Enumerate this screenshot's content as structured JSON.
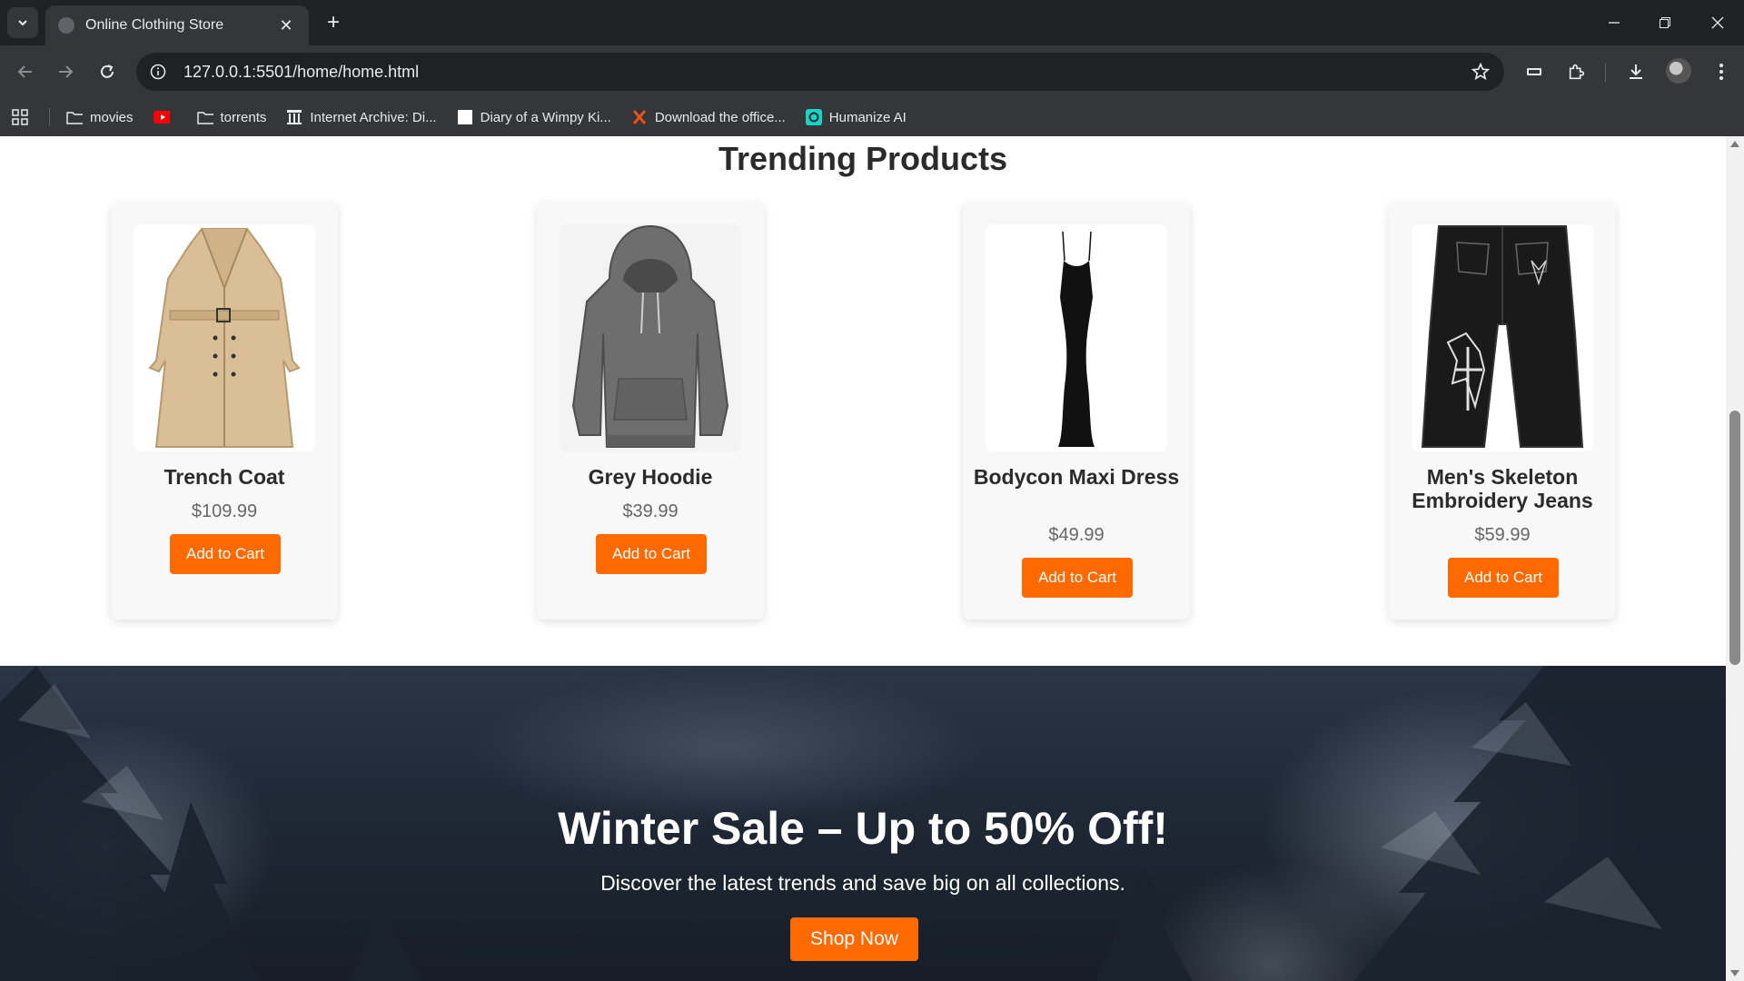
{
  "browser": {
    "tab_title": "Online Clothing Store",
    "url": "127.0.0.1:5501/home/home.html",
    "bookmarks": [
      {
        "label": "movies",
        "icon": "folder-icon"
      },
      {
        "label": "",
        "icon": "youtube-icon"
      },
      {
        "label": "torrents",
        "icon": "folder-icon"
      },
      {
        "label": "Internet Archive: Di...",
        "icon": "archive-icon"
      },
      {
        "label": "Diary of a Wimpy Ki...",
        "icon": "page-icon"
      },
      {
        "label": "Download the office...",
        "icon": "x-icon"
      },
      {
        "label": "Humanize AI",
        "icon": "humanize-icon"
      }
    ]
  },
  "trending": {
    "title": "Trending Products",
    "products": [
      {
        "name": "Trench Coat",
        "price": "$109.99",
        "button": "Add to Cart",
        "image": "trench-coat"
      },
      {
        "name": "Grey Hoodie",
        "price": "$39.99",
        "button": "Add to Cart",
        "image": "grey-hoodie"
      },
      {
        "name": "Bodycon Maxi Dress",
        "price": "$49.99",
        "button": "Add to Cart",
        "image": "black-dress"
      },
      {
        "name": "Men's Skeleton Embroidery Jeans",
        "price": "$59.99",
        "button": "Add to Cart",
        "image": "black-jeans"
      }
    ]
  },
  "banner": {
    "title": "Winter Sale – Up to 50% Off!",
    "subtitle": "Discover the latest trends and save big on all collections.",
    "button": "Shop Now"
  },
  "colors": {
    "accent": "#ff6a00",
    "chrome_dark": "#202124",
    "chrome": "#35363a"
  }
}
